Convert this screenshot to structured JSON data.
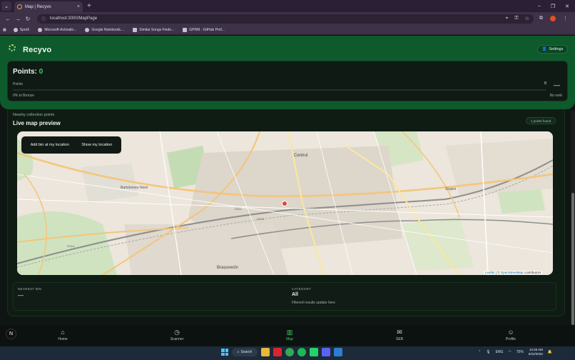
{
  "browser": {
    "tab_title": "Map | Recyvo",
    "tab_close": "×",
    "new_tab": "+",
    "url": "localhost:3000/MapPage",
    "window_controls": [
      "–",
      "❐",
      "✕"
    ],
    "bookmarks": [
      "SpotX",
      "Microsoft-Activatio...",
      "Google NotebookL...",
      "Similar Songs Finde...",
      "GPRM - GitHub Prof..."
    ]
  },
  "app": {
    "brand": "Recyvo",
    "settings_label": "Settings",
    "points": {
      "title": "Points:",
      "value": "0",
      "label": "Points",
      "count": "0",
      "dash": "—",
      "progress_label": "0% to Bronze",
      "progress_fraction": 0,
      "rank_label": "No rank"
    },
    "map_section": {
      "eyebrow": "Nearby collection points",
      "title": "Live map preview",
      "found_badge": "1 points found",
      "add_bin_label": "Add bin at my location",
      "show_location_label": "Show my location",
      "attribution_leaflet": "Leaflet",
      "attribution_sep": "| ©",
      "attribution_osm": "OpenStreetMap",
      "attribution_tail": "contributors",
      "labels": {
        "north": "Bartolomeu Nord",
        "center": "Centrul",
        "south": "Brașovechi",
        "dn11": "DN11",
        "dn1a": "DN1A",
        "dn13": "DN13",
        "stupini": "Stupini"
      }
    },
    "nearest_bin": {
      "label": "NEAREST BIN",
      "value": "—"
    },
    "category": {
      "label": "CATEGORY",
      "value": "All",
      "note": "Filtered results update here"
    },
    "nav": {
      "avatar_letter": "N",
      "items": [
        {
          "label": "Home",
          "icon": "home-icon"
        },
        {
          "label": "Scanner",
          "icon": "clock-icon"
        },
        {
          "label": "Map",
          "icon": "map-icon"
        },
        {
          "label": "SEB",
          "icon": "chat-icon"
        },
        {
          "label": "Profile",
          "icon": "user-icon"
        }
      ]
    }
  },
  "taskbar": {
    "search_label": "Search",
    "lang": "ENG",
    "battery": "75%",
    "time": "12:45 AM",
    "date": "6/22/2026"
  },
  "colors": {
    "accent": "#3fcf6b",
    "header_green": "#0e5a2c",
    "map_marker": "#e0463c"
  }
}
